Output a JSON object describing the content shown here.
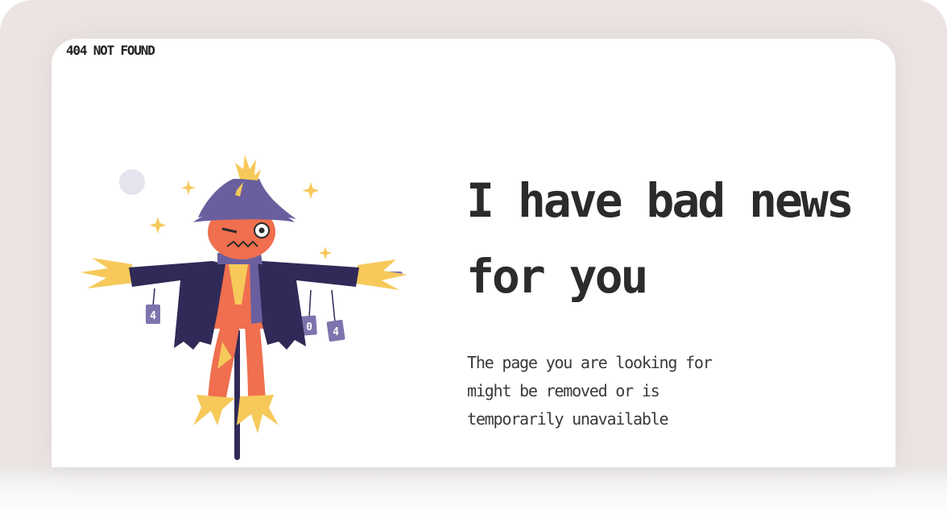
{
  "brand": {
    "text": "404 NOT FOUND"
  },
  "hero": {
    "headline_line1": "I have bad news",
    "headline_line2": "for you",
    "message": "The page you are looking for might be removed or is temporarily unavailable"
  },
  "illustration": {
    "subject": "scarecrow",
    "can_labels": [
      "4",
      "0",
      "4"
    ]
  },
  "colors": {
    "backdrop": "#ebe4e2",
    "card": "#ffffff",
    "text": "#2b2b2b",
    "coat": "#2f2a57",
    "hat": "#6a5f9e",
    "face": "#ef6f4f",
    "straw": "#f6c95a",
    "can": "#7d74ad"
  }
}
